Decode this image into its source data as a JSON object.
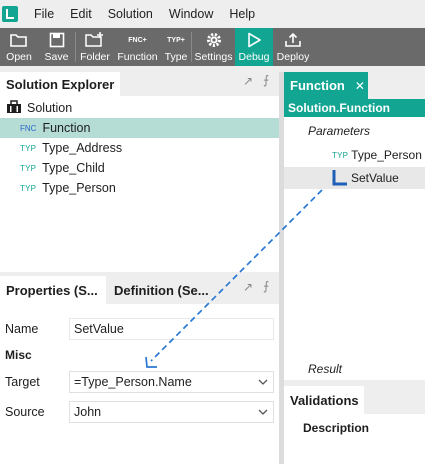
{
  "menu": [
    "File",
    "Edit",
    "Solution",
    "Window",
    "Help"
  ],
  "toolbar": {
    "open": "Open",
    "save": "Save",
    "folder": "Folder",
    "function": "Function",
    "type": "Type",
    "settings": "Settings",
    "debug": "Debug",
    "deploy": "Deploy",
    "fnc_badge": "FNC",
    "typ_badge": "TYP"
  },
  "solution_explorer": {
    "title": "Solution Explorer",
    "root": "Solution",
    "items": [
      {
        "badge": "FNC",
        "label": "Function"
      },
      {
        "badge": "TYP",
        "label": "Type_Address"
      },
      {
        "badge": "TYP",
        "label": "Type_Child"
      },
      {
        "badge": "TYP",
        "label": "Type_Person"
      }
    ]
  },
  "properties": {
    "tab_properties": "Properties (S...",
    "tab_definition": "Definition (Se...",
    "name_label": "Name",
    "name_value": "SetValue",
    "section_misc": "Misc",
    "target_label": "Target",
    "target_value": "=Type_Person.Name",
    "source_label": "Source",
    "source_value": "John"
  },
  "function_editor": {
    "tab": "Function",
    "header": "Solution.Function",
    "parameters": "Parameters",
    "param_badge": "TYP",
    "param": "Type_Person",
    "step": "SetValue",
    "result": "Result"
  },
  "validations": {
    "title": "Validations",
    "description": "Description"
  },
  "colors": {
    "accent": "#12a592",
    "selection": "#b6dcd6",
    "toolbar": "#6a6a6a",
    "connector": "#2a78d4"
  }
}
